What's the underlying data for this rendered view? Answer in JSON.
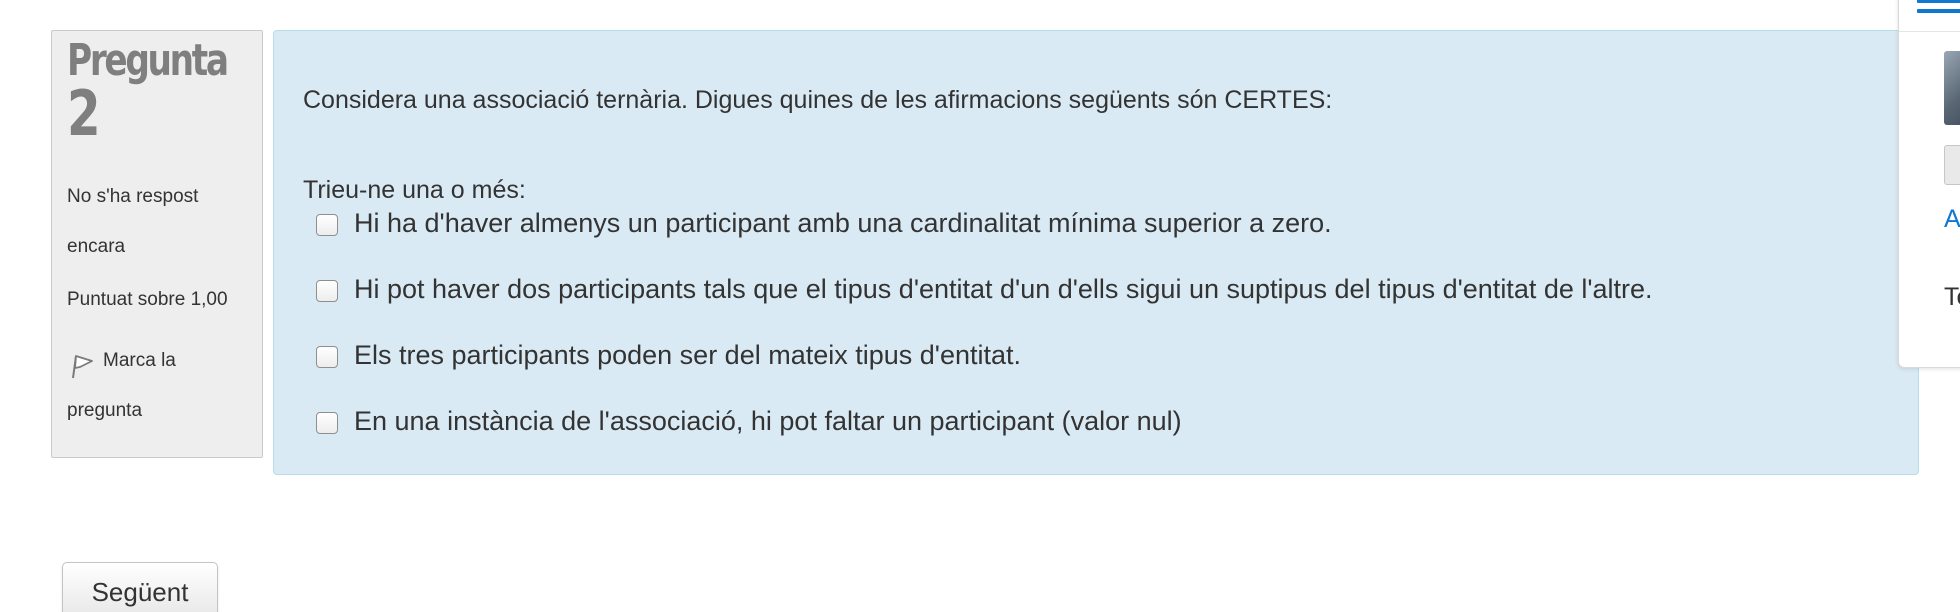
{
  "question_info": {
    "title": "Pregunta",
    "number": "2",
    "state": "No s'ha respost encara",
    "grade": "Puntuat sobre 1,00",
    "flag_label": "Marca la pregunta",
    "flag_icon": "flag-icon"
  },
  "question": {
    "text": "Considera una associació ternària. Digues quines de les afirmacions següents són CERTES:",
    "prompt": "Trieu-ne una o més:",
    "answers": [
      {
        "label": "Hi ha d'haver almenys un participant amb una cardinalitat mínima superior a zero.",
        "checked": false
      },
      {
        "label": "Hi pot haver dos participants tals que el tipus d'entitat d'un d'ells sigui un suptipus del tipus d'entitat de l'altre.",
        "checked": false
      },
      {
        "label": "Els tres participants poden ser del mateix tipus d'entitat.",
        "checked": false
      },
      {
        "label": "En una instància de l'associació, hi pot faltar un participant (valor nul)",
        "checked": false
      }
    ]
  },
  "navigation": {
    "next_label": "Següent"
  },
  "side_block": {
    "menu_icon": "hamburger-menu-icon",
    "link_text": "A",
    "text": "Te"
  },
  "colors": {
    "content_background": "#daeaf4",
    "info_background": "#eeeeee",
    "link": "#1177d1"
  }
}
